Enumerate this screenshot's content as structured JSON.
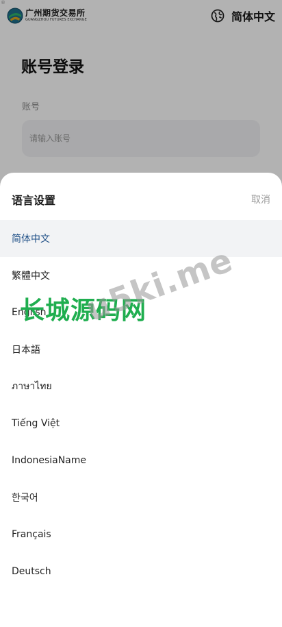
{
  "header": {
    "corner_mark": "®",
    "logo_cn": "广州期货交易所",
    "logo_en": "GUANGZHOU FUTURES EXCHANGE",
    "current_language": "简体中文",
    "globe_icon": "globe-icon"
  },
  "login": {
    "title": "账号登录",
    "account_label": "账号",
    "account_placeholder": "请输入账号"
  },
  "sheet": {
    "title": "语言设置",
    "cancel_label": "取消",
    "languages": [
      {
        "label": "简体中文",
        "selected": true
      },
      {
        "label": "繁體中文",
        "selected": false
      },
      {
        "label": "English",
        "selected": false
      },
      {
        "label": "日本語",
        "selected": false
      },
      {
        "label": "ภาษาไทย",
        "selected": false
      },
      {
        "label": "Tiếng Việt",
        "selected": false
      },
      {
        "label": "IndonesiaName",
        "selected": false
      },
      {
        "label": "한국어",
        "selected": false
      },
      {
        "label": "Français",
        "selected": false
      },
      {
        "label": "Deutsch",
        "selected": false
      }
    ]
  },
  "watermark": {
    "green_text": "长城源码网",
    "gray_text": "u5ki.me"
  },
  "colors": {
    "selected_text": "#1f4f86",
    "selected_bg": "#f2f3f5",
    "overlay": "rgba(0,0,0,0.30)",
    "watermark_green": "#1fae4f"
  }
}
